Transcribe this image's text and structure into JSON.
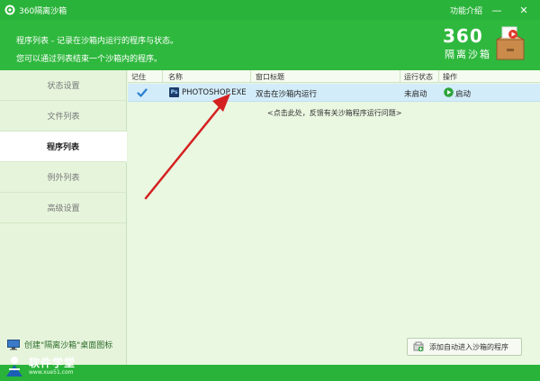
{
  "window": {
    "title": "360隔离沙箱",
    "menu_label": "功能介绍",
    "minimize_glyph": "—",
    "close_glyph": "✕"
  },
  "header": {
    "line1": "程序列表 - 记录在沙箱内运行的程序与状态。",
    "line2": "您可以通过列表结束一个沙箱内的程序。",
    "brand_number": "360",
    "brand_name": "隔离沙箱"
  },
  "sidebar": {
    "items": [
      {
        "label": "状态设置"
      },
      {
        "label": "文件列表"
      },
      {
        "label": "程序列表"
      },
      {
        "label": "例外列表"
      },
      {
        "label": "高级设置"
      }
    ],
    "active_index": 2,
    "desktop_shortcut_label": "创建\"隔离沙箱\"桌面图标"
  },
  "table": {
    "columns": [
      "记住",
      "名称",
      "窗口标题",
      "运行状态",
      "操作"
    ],
    "rows": [
      {
        "remember_icon": "check-icon",
        "name_icon": "photoshop-icon",
        "name_icon_text": "Ps",
        "name": "PHOTOSHOP.EXE",
        "window_title": "双击在沙箱内运行",
        "status": "未启动",
        "action_icon": "play-icon",
        "action": "启动"
      }
    ],
    "feedback_link": "<点击此处，反馈有关沙箱程序运行问题>"
  },
  "bottom_button": {
    "label": "添加自动进入沙箱的程序",
    "icon": "add-program-icon"
  },
  "site_logo": {
    "name": "软件学堂",
    "url": "www.xue51.com"
  },
  "colors": {
    "title_green": "#2ab33a",
    "header_green": "#2fb83e",
    "body_bg": "#e9f6df",
    "row_highlight": "#d3ecf9",
    "arrow_red": "#d42020"
  }
}
